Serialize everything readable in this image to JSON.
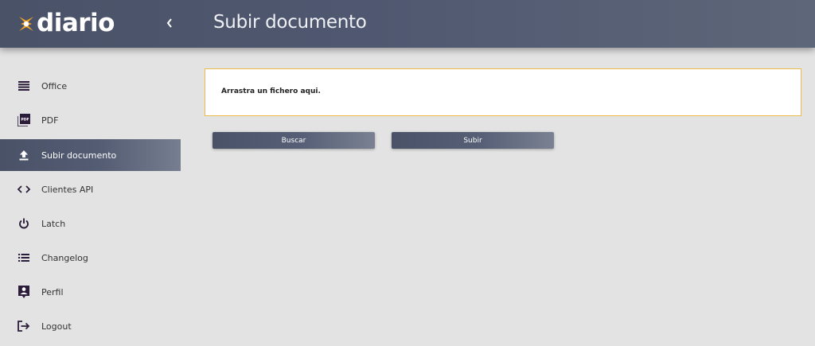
{
  "app": {
    "logo_text": "diario",
    "logo_icon": "x-star-logo",
    "collapse_icon": "chevron-left-icon"
  },
  "header": {
    "title": "Subir documento"
  },
  "sidebar": {
    "items": [
      {
        "label": "Office",
        "icon": "list-lines-icon"
      },
      {
        "label": "PDF",
        "icon": "pdf-icon"
      },
      {
        "label": "Subir documento",
        "icon": "upload-icon",
        "active": true
      },
      {
        "label": "Clientes API",
        "icon": "code-icon"
      },
      {
        "label": "Latch",
        "icon": "power-icon"
      },
      {
        "label": "Changelog",
        "icon": "list-bullets-icon"
      },
      {
        "label": "Perfil",
        "icon": "contact-card-icon"
      },
      {
        "label": "Logout",
        "icon": "logout-icon"
      }
    ]
  },
  "main": {
    "dropzone_text": "Arrastra un fichero aqui.",
    "buttons": {
      "search_label": "Buscar",
      "upload_label": "Subir"
    }
  },
  "colors": {
    "header": "#4f5870",
    "accent_border": "#f0b84a",
    "logo_orange": "#f5a623",
    "icon_dark": "#2b1d3a"
  }
}
